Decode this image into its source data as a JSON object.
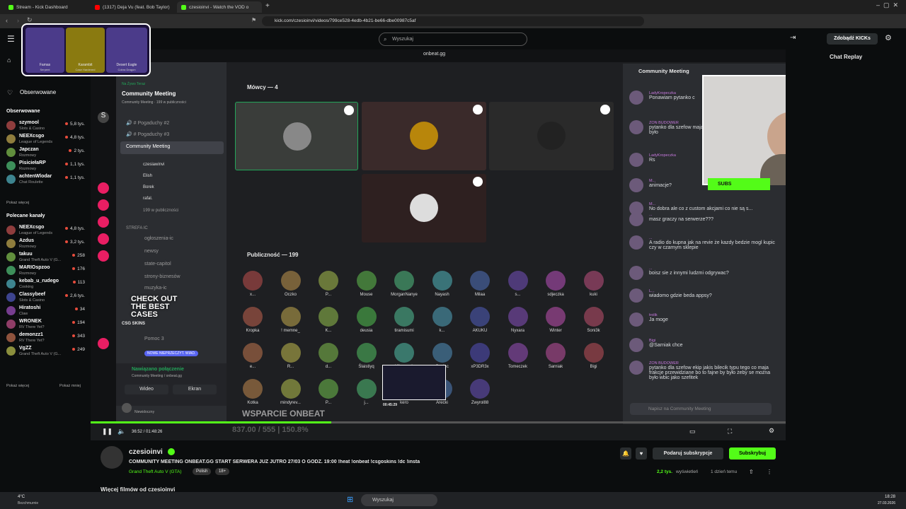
{
  "browser": {
    "tabs": [
      {
        "label": "Stream - Kick Dashboard"
      },
      {
        "label": "(1317) Deja Vu (feat. Bob Taylor)"
      },
      {
        "label": "czesioinvi - Watch the VOD o"
      }
    ],
    "url": "kick.com/czesioinvi/videos/799ce528-4edb-4b21-be66-dbe00987c5af"
  },
  "kick": {
    "search_placeholder": "Wyszukaj",
    "kicks_button": "Zdobądź KICKs",
    "chat_replay": "Chat Replay",
    "followed_label": "Obserwowane",
    "followed_section": "Obserwowane",
    "show_more_followed": "Pokaż więcej",
    "recommended_section": "Polecane kanały",
    "show_more": "Pokaż więcej",
    "show_less": "Pokaż mniej",
    "followed": [
      {
        "name": "szymool",
        "game": "Slots & Casino",
        "viewers": "5,8 tys."
      },
      {
        "name": "NEEXcsgo",
        "game": "League of Legends",
        "viewers": "4,8 tys."
      },
      {
        "name": "Japczan",
        "game": "Rozmowy",
        "viewers": "2 tys."
      },
      {
        "name": "PisiciełaRP",
        "game": "Rozmowy",
        "viewers": "1,1 tys."
      },
      {
        "name": "achtenWlodar",
        "game": "Chat Roulette",
        "viewers": "1,1 tys."
      }
    ],
    "recommended": [
      {
        "name": "NEEXcsgo",
        "game": "League of Legends",
        "viewers": "4,8 tys."
      },
      {
        "name": "Azdus",
        "game": "Rozmowy",
        "viewers": "3,2 tys."
      },
      {
        "name": "takuu",
        "game": "Grand Theft Auto V (G...",
        "viewers": "258"
      },
      {
        "name": "MARIOspzoo",
        "game": "Rozmowy",
        "viewers": "176"
      },
      {
        "name": "kebab_u_rudego",
        "game": "Cooking",
        "viewers": "113"
      },
      {
        "name": "Classybeef",
        "game": "Slots & Casino",
        "viewers": "2,6 tys."
      },
      {
        "name": "Hiratoshi",
        "game": "Claw",
        "viewers": "34"
      },
      {
        "name": "WRONEK",
        "game": "RV There Yet?",
        "viewers": "194"
      },
      {
        "name": "demonzz1",
        "game": "RV There Yet?",
        "viewers": "343"
      },
      {
        "name": "VgZZ",
        "game": "Grand Theft Auto V (G...",
        "viewers": "249"
      }
    ]
  },
  "discord": {
    "top_label": "onbeat.gg",
    "live_label": "Na Żywo Teraz",
    "event_title": "Community Meeting",
    "event_sub": "Community Meeting · 199 w publiczności",
    "speakers_header": "Mówcy — 4",
    "audience_header": "Publiczność — 199",
    "right_title": "Community Meeting",
    "channels": [
      "Pogaduchy #2",
      "Pogaduchy #3",
      "Community Meeting"
    ],
    "stage_users": [
      "czesiawinvi",
      "Elish",
      "Borek",
      "rafal."
    ],
    "audience_count": "199 w publiczności",
    "category": "STREFA IC",
    "text_channels": [
      "ogłoszenia-ic",
      "newsy",
      "state-capitol",
      "strony-biznesów",
      "muzyka-ic"
    ],
    "pomoc": "Pomoc 3",
    "new_unread": "NOWE NIEPRZECZYT. WIAD.",
    "connected": "Nawiązano połączenie",
    "connected_sub": "Community Meeting / onbeat.gg",
    "video_btn": "Wideo",
    "screen_btn": "Ekran",
    "user_status": "Niewidoczny",
    "message_placeholder": "Napisz na Community Meeting",
    "audience": [
      "x...",
      "Oczko",
      "P...",
      "Mouse",
      "MorganNanye",
      "Nayash",
      "Milaa",
      "s...",
      "sdjeczka",
      "kuki",
      "Kropka",
      "! memne_",
      "K...",
      "deusia",
      "tiramisumi",
      "k...",
      "AKUKU",
      "Nyxara",
      "Winter",
      "Soni3k",
      "e...",
      "R...",
      "d...",
      "Ślaistiyq",
      "Ulbraszek",
      "Guziec",
      "xP3DR3x",
      "Tomeczek",
      "Sarniak",
      "Bigi",
      "Kotka",
      "mindyrev...",
      "P...",
      "j...",
      "kero",
      "Arecki",
      "Zwyrol88"
    ],
    "messages": [
      {
        "user": "LadyKropeczka",
        "text": "Ponawiam pytanko c"
      },
      {
        "user": "ZON BUDOWER",
        "text": "pytanko dla szefow maja frakcje przewidz żeby se można było"
      },
      {
        "user": "LadyKropeczka",
        "text": "Rs"
      },
      {
        "user": "M...",
        "text": "animacje?"
      },
      {
        "user": "M...",
        "text": "No dobra ale co z custom akcjami co nie są s..."
      },
      {
        "user": "...",
        "text": "masz graczy na serwerze???"
      },
      {
        "user": "...",
        "text": "A radio do kupna jak na revie że kazdy bedzie mogl kupic czy w czarnym sklepie"
      },
      {
        "user": "...",
        "text": "boisz sie z innymi ludzmi odgrywac?"
      },
      {
        "user": "L...",
        "text": "wiadomo gdzie beda appsy?"
      },
      {
        "user": "trolik",
        "text": "Ja moge"
      },
      {
        "user": "Bigi",
        "text": "@Sarniak chce"
      },
      {
        "user": "ZON BUDOWER",
        "text": "pytanko dla szefow ekip jakis bilecik typu tego co maja frakcje przewidziane bo to fajne by było żeby se można było wbic jako szefitek"
      }
    ]
  },
  "overlay": {
    "gun1": "Famas",
    "gun1_sub": "Serpent",
    "gun2": "Karambit",
    "gun2_sub": "Case Hardened",
    "gun3": "Desert Eagle",
    "gun3_sub": "Cobra Dragon",
    "checkout": "CHECK OUT THE BEST CASES",
    "csgo": "CSG SKINS",
    "subs": "SUBS",
    "wsparcie": "WSPARCIE ONBEAT",
    "thumb_time": "00:45:29",
    "goal": "837.00 / 555 | 150.8%"
  },
  "player": {
    "time": "36:52 / 01:48:26"
  },
  "stream": {
    "streamer": "czesioinvi",
    "title": "COMMUNITY MEETING ONBEAT.GG START SERWERA JUZ JUTRO 27/03 O GODZ. 19:00 !heat !onbeat !csgoskins !dc !insta",
    "category": "Grand Theft Auto V (GTA)",
    "lang": "Polish",
    "age": "18+",
    "gift_btn": "Podaruj subskrypcje",
    "sub_btn": "Subskrybuj",
    "views": "2,2 tys.",
    "views_label": "wyświetleń",
    "ago": "1 dzień temu",
    "more_videos": "Więcej filmów od czesioinvi"
  },
  "taskbar": {
    "weather": "4°C",
    "weather_sub": "Bezchmurnie",
    "search": "Wyszukaj",
    "time": "18:28",
    "date": "27.03.2026"
  },
  "colors": {
    "kick_green": "#53fc18",
    "discord_bg": "#1e1f22",
    "page_bg": "#0b0d0e"
  }
}
